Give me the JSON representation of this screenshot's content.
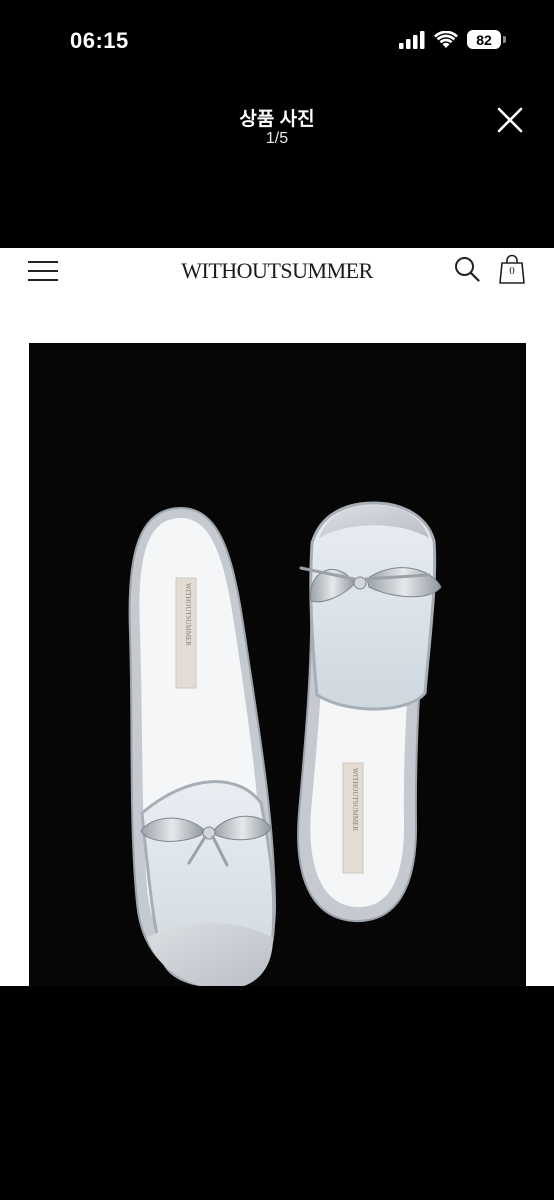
{
  "status_bar": {
    "time": "06:15",
    "battery_level": "82",
    "icons": [
      "cellular-signal-icon",
      "wifi-icon",
      "battery-icon"
    ]
  },
  "viewer": {
    "title": "상품 사진",
    "counter": "1/5",
    "close_icon": "close-icon"
  },
  "photo": {
    "site_header": {
      "menu_icon": "hamburger-menu-icon",
      "brand": "WITHOUTSUMMER",
      "search_icon": "search-icon",
      "cart_icon": "shopping-bag-icon",
      "cart_count": "0"
    },
    "product_image": {
      "insole_brand_text": "WITHOUTSUMMER"
    }
  },
  "colors": {
    "background": "#000000",
    "photo_background": "#ffffff",
    "product_backdrop": "#060606",
    "text_light": "#ffffff"
  }
}
